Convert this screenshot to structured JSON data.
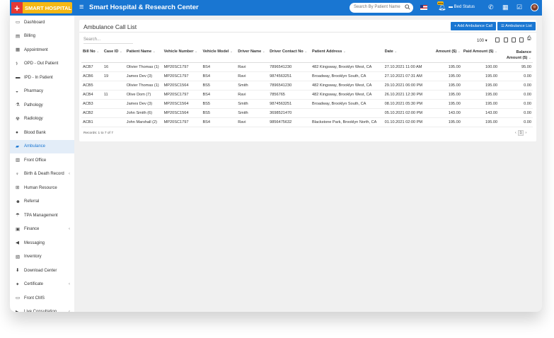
{
  "header": {
    "logo_text": "SMART HOSPITAL",
    "app_title": "Smart Hospital & Research Center",
    "search_placeholder": "Search By Patient Name",
    "bed_status_label": "Bed Status",
    "notification_badge": "new",
    "brand_color": "#1976d2"
  },
  "sidebar": {
    "items": [
      {
        "label": "Dashboard",
        "icon": "desktop-icon"
      },
      {
        "label": "Billing",
        "icon": "file-icon"
      },
      {
        "label": "Appointment",
        "icon": "calendar-icon"
      },
      {
        "label": "OPD - Out Patient",
        "icon": "stethoscope-icon"
      },
      {
        "label": "IPD - In Patient",
        "icon": "bed-icon"
      },
      {
        "label": "Pharmacy",
        "icon": "mortar-icon"
      },
      {
        "label": "Pathology",
        "icon": "flask-icon"
      },
      {
        "label": "Radiology",
        "icon": "radiation-icon"
      },
      {
        "label": "Blood Bank",
        "icon": "tint-icon"
      },
      {
        "label": "Ambulance",
        "icon": "ambulance-icon"
      },
      {
        "label": "Front Office",
        "icon": "dumpster-icon"
      },
      {
        "label": "Birth & Death Record",
        "icon": "birthday-icon"
      },
      {
        "label": "Human Resource",
        "icon": "sitemap-icon"
      },
      {
        "label": "Referral",
        "icon": "users-icon"
      },
      {
        "label": "TPA Management",
        "icon": "umbrella-icon"
      },
      {
        "label": "Finance",
        "icon": "money-icon"
      },
      {
        "label": "Messaging",
        "icon": "bullhorn-icon"
      },
      {
        "label": "Inventory",
        "icon": "box-icon"
      },
      {
        "label": "Download Center",
        "icon": "download-icon"
      },
      {
        "label": "Certificate",
        "icon": "certificate-icon"
      },
      {
        "label": "Front CMS",
        "icon": "desktop-icon"
      },
      {
        "label": "Live Consultation",
        "icon": "video-icon"
      }
    ],
    "active_label": "Ambulance"
  },
  "main": {
    "title": "Ambulance Call List",
    "add_button": "+ Add Ambulance Call",
    "list_button": "Ambulance List",
    "search_placeholder": "Search...",
    "page_size": "100",
    "columns": [
      "Bill No",
      "Case ID",
      "Patient Name",
      "Vehicle Number",
      "Vehicle Model",
      "Driver Name",
      "Driver Contact No",
      "Patient Address",
      "Date",
      "Amount ($)",
      "Paid Amount ($)",
      "Balance Amount ($)"
    ],
    "rows": [
      [
        "ACB7",
        "16",
        "Olivier Thomas (1)",
        "MP20SC1797",
        "BS4",
        "Ravi",
        "7896541230",
        "482 Kingsway, Brooklyn West, CA",
        "27.10.2021 11:00 AM",
        "195.00",
        "100.00",
        "95.00"
      ],
      [
        "ACB6",
        "19",
        "James Dev (3)",
        "MP20SC1797",
        "BS4",
        "Ravi",
        "9874563251",
        "Broadway, Brooklyn South, CA",
        "27.10.2021 07:31 AM",
        "195.00",
        "195.00",
        "0.00"
      ],
      [
        "ACB5",
        "",
        "Olivier Thomas (1)",
        "MP20SC1564",
        "BS5",
        "Smith",
        "7896541230",
        "482 Kingsway, Brooklyn West, CA",
        "29.10.2021 06:00 PM",
        "195.00",
        "195.00",
        "0.00"
      ],
      [
        "ACB4",
        "11",
        "Olive Dom (7)",
        "MP20SC1797",
        "BS4",
        "Ravi",
        "7856765",
        "482 Kingsway, Brooklyn West, CA",
        "26.10.2021 12:30 PM",
        "195.00",
        "195.00",
        "0.00"
      ],
      [
        "ACB3",
        "",
        "James Dev (3)",
        "MP20SC1564",
        "BS5",
        "Smith",
        "9874563251",
        "Broadway, Brooklyn South, CA",
        "08.10.2021 05:30 PM",
        "195.00",
        "195.00",
        "0.00"
      ],
      [
        "ACB2",
        "",
        "John Smith (6)",
        "MP20SC1564",
        "BS5",
        "Smith",
        "3698521470",
        "",
        "05.10.2021 02:00 PM",
        "143.00",
        "143.00",
        "0.00"
      ],
      [
        "ACB1",
        "",
        "John Marshall (2)",
        "MP20SC1797",
        "BS4",
        "Ravi",
        "9856475632",
        "Blackstone Park, Brooklyn North, CA",
        "01.10.2021 02:00 PM",
        "195.00",
        "195.00",
        "0.00"
      ]
    ],
    "records_text": "Records: 1 to 7 of 7",
    "current_page": "1"
  }
}
